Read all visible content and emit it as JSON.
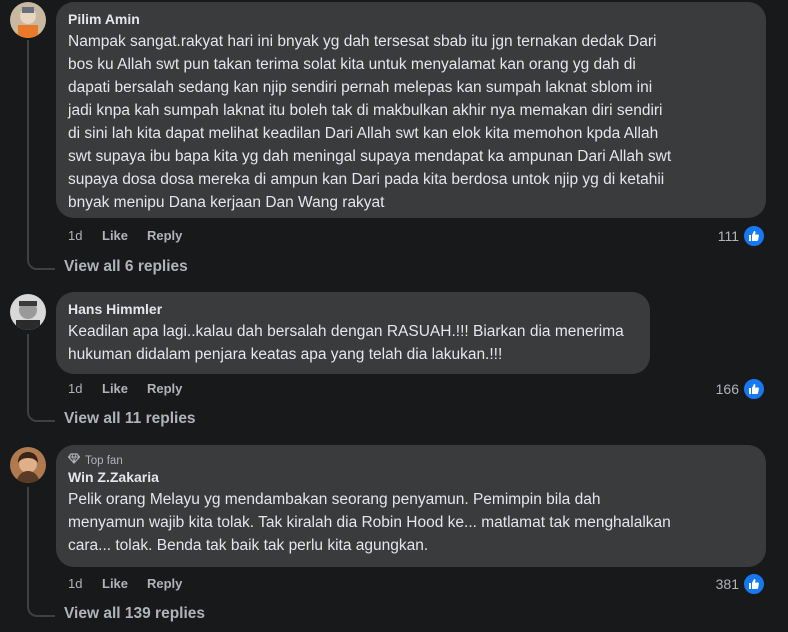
{
  "comments": [
    {
      "author": "Pilim Amin",
      "lines": [
        "Nampak sangat.rakyat hari ini bnyak yg dah tersesat sbab itu jgn ternakan dedak Dari",
        "bos ku Allah swt pun takan terima solat kita untuk menyalamat kan orang yg dah di",
        "dapati bersalah sedang kan njip sendiri pernah melepas kan sumpah laknat sblom ini",
        "jadi knpa kah sumpah laknat itu boleh tak di makbulkan akhir nya memakan diri sendiri",
        "di sini lah kita dapat melihat keadilan Dari Allah swt kan elok kita memohon kpda Allah",
        "swt supaya ibu bapa kita yg dah meningal supaya mendapat ka ampunan Dari Allah swt",
        "supaya dosa dosa mereka di ampun kan Dari pada kita berdosa untok njip yg di ketahii",
        "bnyak menipu Dana kerjaan Dan Wang rakyat"
      ],
      "time": "1d",
      "like_label": "Like",
      "reply_label": "Reply",
      "reactions": "111",
      "view_replies": "View all 6 replies"
    },
    {
      "author": "Hans Himmler",
      "lines": [
        "Keadilan apa lagi..kalau dah bersalah dengan RASUAH.!!! Biarkan dia menerima",
        "hukuman didalam penjara keatas apa yang telah dia lakukan.!!!"
      ],
      "time": "1d",
      "like_label": "Like",
      "reply_label": "Reply",
      "reactions": "166",
      "view_replies": "View all 11 replies"
    },
    {
      "badge": "Top fan",
      "author": "Win Z.Zakaria",
      "lines": [
        "Pelik orang Melayu yg mendambakan seorang penyamun. Pemimpin bila dah",
        "menyamun wajib kita tolak. Tak kiralah dia Robin Hood ke... matlamat tak menghalalkan",
        "cara... tolak. Benda tak baik tak perlu kita agungkan."
      ],
      "time": "1d",
      "like_label": "Like",
      "reply_label": "Reply",
      "reactions": "381",
      "view_replies": "View all 139 replies"
    }
  ],
  "icons": {
    "reaction": "thumbs-up-icon",
    "badge": "diamond-icon"
  },
  "colors": {
    "like_blue": "#1877f2",
    "bubble": "#3a3b3c",
    "background": "#18191a"
  }
}
